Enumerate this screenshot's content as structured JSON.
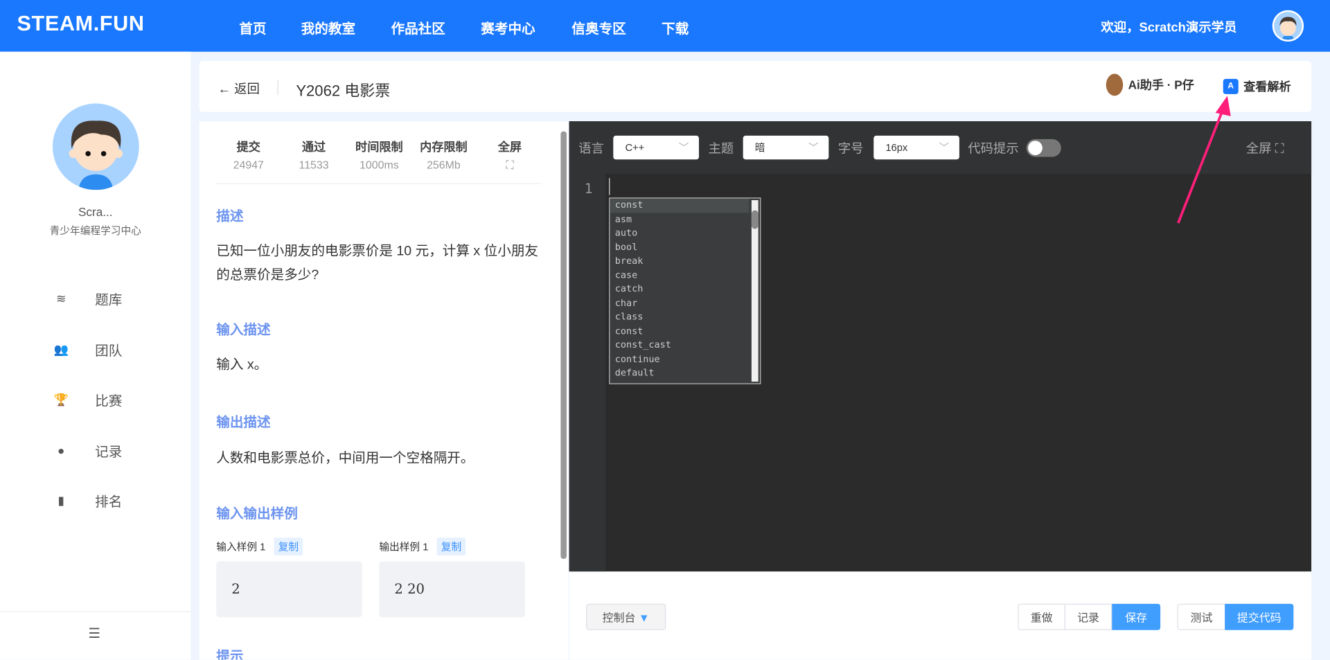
{
  "header": {
    "logo": "STEAM.FUN",
    "nav": [
      "首页",
      "我的教室",
      "作品社区",
      "赛考中心",
      "信奥专区",
      "下载"
    ],
    "welcome": "欢迎，Scratch演示学员"
  },
  "sidebar": {
    "username": "Scra...",
    "org": "青少年编程学习中心",
    "items": [
      {
        "label": "题库",
        "icon": "hat-icon"
      },
      {
        "label": "团队",
        "icon": "users-icon"
      },
      {
        "label": "比赛",
        "icon": "trophy-icon"
      },
      {
        "label": "记录",
        "icon": "clock-icon"
      },
      {
        "label": "排名",
        "icon": "bar-chart-icon"
      }
    ]
  },
  "problem_header": {
    "back": "返回",
    "title": "Y2062 电影票",
    "ai": "Ai助手 · P仔",
    "solution": "查看解析"
  },
  "stats": [
    {
      "k": "提交",
      "v": "24947"
    },
    {
      "k": "通过",
      "v": "11533"
    },
    {
      "k": "时间限制",
      "v": "1000ms"
    },
    {
      "k": "内存限制",
      "v": "256Mb"
    },
    {
      "k": "全屏",
      "v": "⛶"
    }
  ],
  "problem": {
    "desc_title": "描述",
    "desc": "已知一位小朋友的电影票价是 10 元，计算 x 位小朋友的总票价是多少?",
    "input_title": "输入描述",
    "input": "输入 x。",
    "output_title": "输出描述",
    "output": "人数和电影票总价，中间用一个空格隔开。",
    "samples_title": "输入输出样例",
    "sample_in_label": "输入样例 1",
    "sample_out_label": "输出样例 1",
    "copy": "复制",
    "sample_in": "2",
    "sample_out": "2 20",
    "hint_title": "提示"
  },
  "editor": {
    "lang_label": "语言",
    "lang": "C++",
    "theme_label": "主题",
    "theme": "暗",
    "font_label": "字号",
    "font": "16px",
    "hint_label": "代码提示",
    "hint_on": false,
    "fullscreen": "全屏",
    "line": "1",
    "autocomplete": [
      "const",
      "asm",
      "auto",
      "bool",
      "break",
      "case",
      "catch",
      "char",
      "class",
      "const",
      "const_cast",
      "continue",
      "default"
    ]
  },
  "footer": {
    "console": "控制台",
    "redo": "重做",
    "record": "记录",
    "save": "保存",
    "test": "测试",
    "submit": "提交代码"
  },
  "colors": {
    "brand": "#1a78ff",
    "accent": "#409eff",
    "arrow": "#ff1f7a"
  }
}
